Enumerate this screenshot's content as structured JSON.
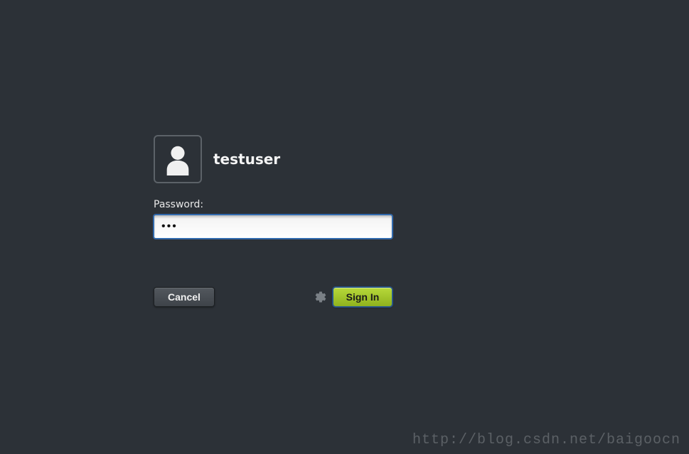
{
  "login": {
    "username": "testuser",
    "password_label": "Password:",
    "password_value": "•••",
    "cancel_label": "Cancel",
    "signin_label": "Sign In"
  },
  "watermark": "http://blog.csdn.net/baigoocn"
}
